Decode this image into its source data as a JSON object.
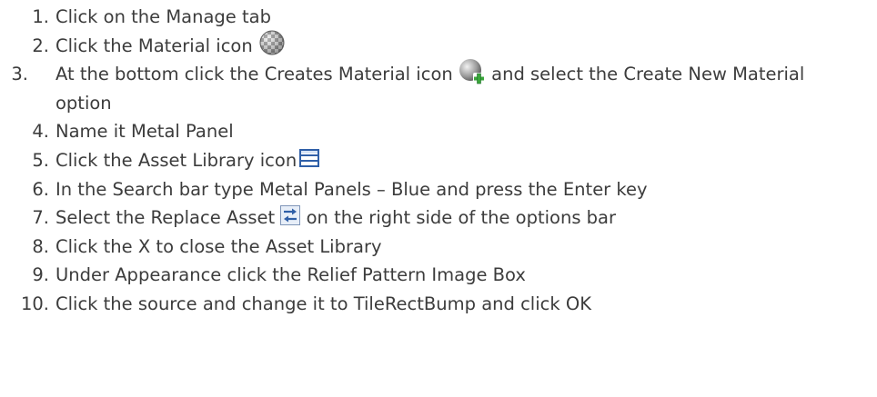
{
  "steps": [
    {
      "num": "1.",
      "text": "Click on the Manage tab"
    },
    {
      "num": "2.",
      "text": "Click the Material icon",
      "icon": "material-sphere-icon"
    },
    {
      "num": "3.",
      "text_a": "At the bottom click the Creates Material icon",
      "icon": "create-material-plus-icon",
      "text_b": "and select the Create New Material option"
    },
    {
      "num": "4.",
      "text": "Name it Metal Panel"
    },
    {
      "num": "5.",
      "text": "Click the Asset Library icon",
      "icon": "asset-library-panel-icon"
    },
    {
      "num": "6.",
      "text": "In the Search bar type Metal Panels – Blue and press the Enter key"
    },
    {
      "num": "7.",
      "text_a": "Select the Replace Asset",
      "icon": "replace-asset-swap-icon",
      "text_b": "on the right side of the options bar"
    },
    {
      "num": "8.",
      "text": "Click the X to close the Asset Library"
    },
    {
      "num": "9.",
      "text": "Under Appearance click the Relief Pattern Image Box"
    },
    {
      "num": "10.",
      "text": "Click the source and change it to TileRectBump and click OK"
    }
  ],
  "colors": {
    "text": "#3c3c3c",
    "icon_blue": "#2f5fa8",
    "plus_green": "#3aa63a"
  }
}
